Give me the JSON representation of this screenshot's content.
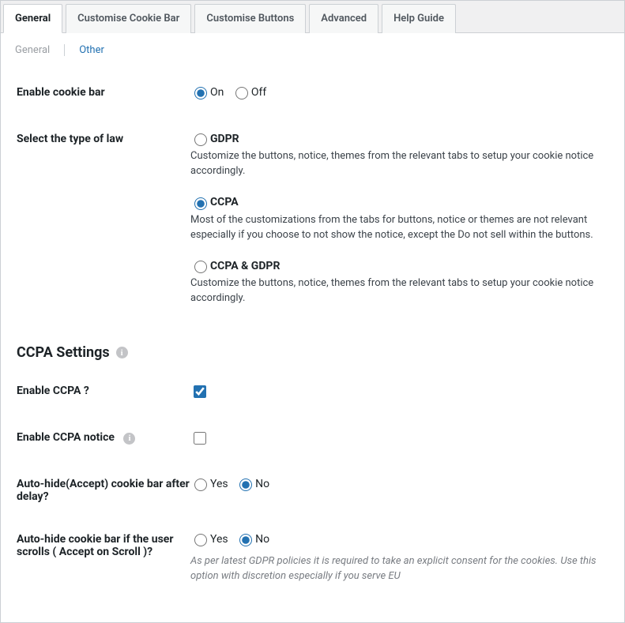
{
  "tabs_top": [
    {
      "label": "General",
      "active": true
    },
    {
      "label": "Customise Cookie Bar",
      "active": false
    },
    {
      "label": "Customise Buttons",
      "active": false
    },
    {
      "label": "Advanced",
      "active": false
    },
    {
      "label": "Help Guide",
      "active": false
    }
  ],
  "subtabs": [
    {
      "label": "General",
      "active": true
    },
    {
      "label": "Other",
      "active": false
    }
  ],
  "enable_cookie_bar": {
    "label": "Enable cookie bar",
    "options": {
      "on": "On",
      "off": "Off"
    },
    "selected": "on"
  },
  "law_type": {
    "label": "Select the type of law",
    "selected": "ccpa",
    "options": {
      "gdpr": {
        "label": "GDPR",
        "desc": "Customize the buttons, notice, themes from the relevant tabs to setup your cookie notice accordingly."
      },
      "ccpa": {
        "label": "CCPA",
        "desc": "Most of the customizations from the tabs for buttons, notice or themes are not relevant especially if you choose to not show the notice, except the Do not sell within the buttons."
      },
      "both": {
        "label": "CCPA & GDPR",
        "desc": "Customize the buttons, notice, themes from the relevant tabs to setup your cookie notice accordingly."
      }
    }
  },
  "ccpa_section": {
    "heading": "CCPA Settings"
  },
  "enable_ccpa": {
    "label": "Enable CCPA ?",
    "checked": true
  },
  "enable_ccpa_notice": {
    "label": "Enable CCPA notice",
    "checked": false
  },
  "autohide_delay": {
    "label": "Auto-hide(Accept) cookie bar after delay?",
    "options": {
      "yes": "Yes",
      "no": "No"
    },
    "selected": "no"
  },
  "autohide_scroll": {
    "label": "Auto-hide cookie bar if the user scrolls ( Accept on Scroll )?",
    "options": {
      "yes": "Yes",
      "no": "No"
    },
    "selected": "no",
    "hint": "As per latest GDPR policies it is required to take an explicit consent for the cookies. Use this option with discretion especially if you serve EU"
  },
  "info_glyph": "i"
}
